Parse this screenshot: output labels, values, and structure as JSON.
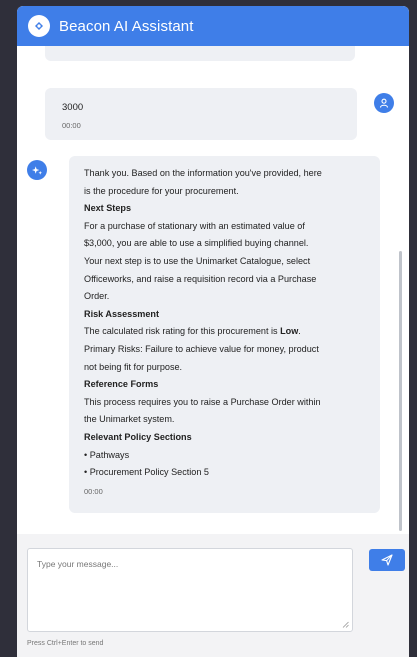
{
  "header": {
    "title": "Beacon AI Assistant",
    "logo_icon": "beacon-logo-icon",
    "accent_color": "#3f7ee8"
  },
  "messages": [
    {
      "role": "user",
      "text": "3000",
      "time": "00:00",
      "avatar_icon": "user-icon"
    },
    {
      "role": "assistant",
      "avatar_icon": "sparkle-icon",
      "lines": [
        {
          "text": "Thank you. Based on the information you've provided, here",
          "bold": false
        },
        {
          "text": "is the procedure for your procurement.",
          "bold": false
        },
        {
          "text": "Next Steps",
          "bold": true
        },
        {
          "text": "For a purchase of stationary with an estimated value of",
          "bold": false
        },
        {
          "text": "$3,000, you are able to use a simplified buying channel.",
          "bold": false
        },
        {
          "text": "Your next step is to use the Unimarket Catalogue, select",
          "bold": false
        },
        {
          "text": "Officeworks, and raise a requisition record via a Purchase",
          "bold": false
        },
        {
          "text": "Order.",
          "bold": false
        },
        {
          "text": "Risk Assessment",
          "bold": true
        },
        {
          "text": "The calculated risk rating for this procurement is ",
          "bold": false,
          "emphasis": "Low",
          "suffix": "."
        },
        {
          "text": "Primary Risks: Failure to achieve value for money, product",
          "bold": false
        },
        {
          "text": "not being fit for purpose.",
          "bold": false
        },
        {
          "text": "Reference Forms",
          "bold": true
        },
        {
          "text": "This process requires you to raise a Purchase Order within",
          "bold": false
        },
        {
          "text": "the Unimarket system.",
          "bold": false
        },
        {
          "text": "Relevant Policy Sections",
          "bold": true
        },
        {
          "text": "• Pathways",
          "bold": false
        },
        {
          "text": "• Procurement Policy Section 5",
          "bold": false
        }
      ],
      "time": "00:00"
    }
  ],
  "composer": {
    "placeholder": "Type your message...",
    "value": "",
    "send_icon": "send-icon",
    "hint": "Press Ctrl+Enter to send"
  }
}
